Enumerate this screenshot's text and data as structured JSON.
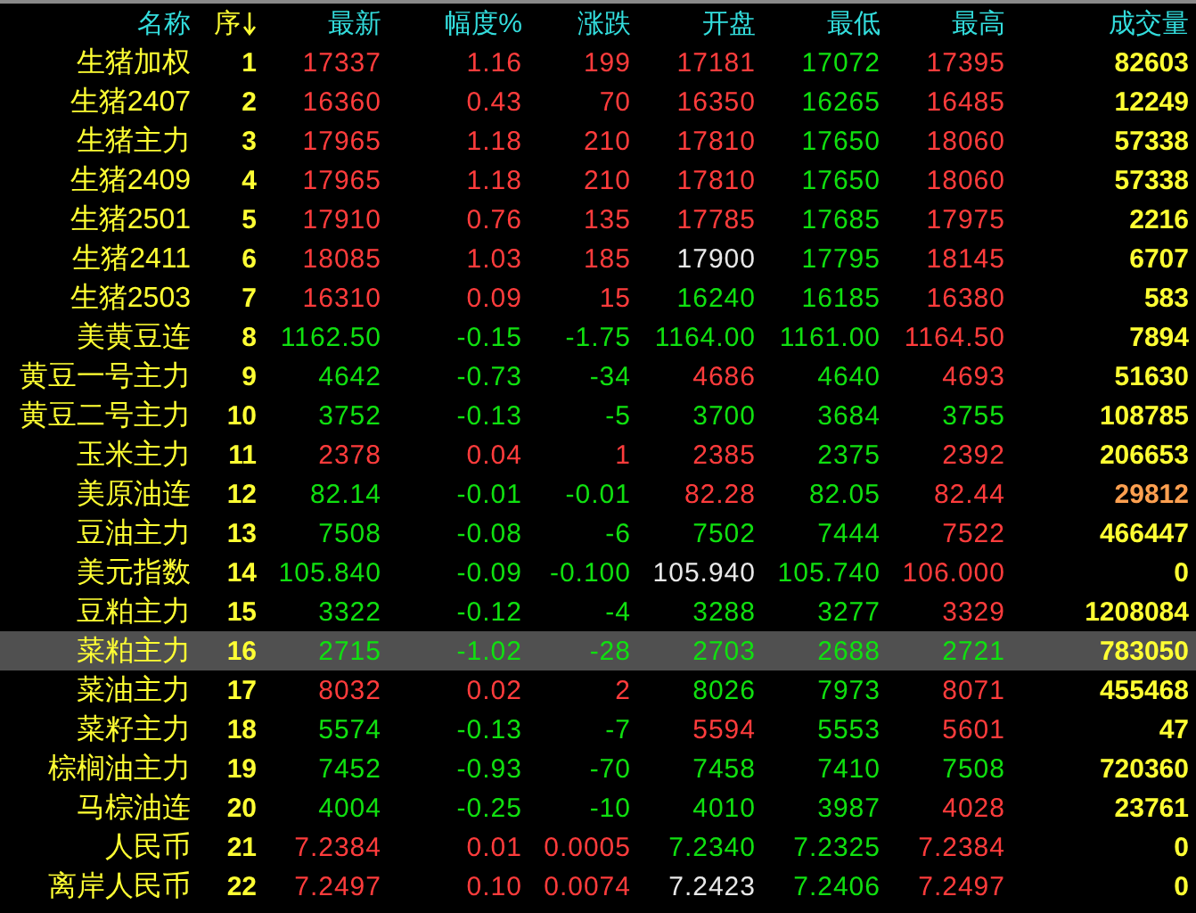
{
  "columns": [
    {
      "label": "名称",
      "sorted": false
    },
    {
      "label": "序",
      "sorted": true
    },
    {
      "label": "最新",
      "sorted": false
    },
    {
      "label": "幅度%",
      "sorted": false
    },
    {
      "label": "涨跌",
      "sorted": false
    },
    {
      "label": "开盘",
      "sorted": false
    },
    {
      "label": "最低",
      "sorted": false
    },
    {
      "label": "最高",
      "sorted": false
    },
    {
      "label": "成交量",
      "sorted": false
    }
  ],
  "rows": [
    {
      "name": "生猪加权",
      "seq": "1",
      "selected": false,
      "cells": [
        {
          "v": "17337",
          "color": "#ff3c3c"
        },
        {
          "v": "1.16",
          "color": "#ff3c3c"
        },
        {
          "v": "199",
          "color": "#ff3c3c"
        },
        {
          "v": "17181",
          "color": "#ff3c3c"
        },
        {
          "v": "17072",
          "color": "#10e010"
        },
        {
          "v": "17395",
          "color": "#ff3c3c"
        }
      ],
      "volume": {
        "v": "82603",
        "changed": false
      }
    },
    {
      "name": "生猪2407",
      "seq": "2",
      "selected": false,
      "cells": [
        {
          "v": "16360",
          "color": "#ff3c3c"
        },
        {
          "v": "0.43",
          "color": "#ff3c3c"
        },
        {
          "v": "70",
          "color": "#ff3c3c"
        },
        {
          "v": "16350",
          "color": "#ff3c3c"
        },
        {
          "v": "16265",
          "color": "#10e010"
        },
        {
          "v": "16485",
          "color": "#ff3c3c"
        }
      ],
      "volume": {
        "v": "12249",
        "changed": false
      }
    },
    {
      "name": "生猪主力",
      "seq": "3",
      "selected": false,
      "cells": [
        {
          "v": "17965",
          "color": "#ff3c3c"
        },
        {
          "v": "1.18",
          "color": "#ff3c3c"
        },
        {
          "v": "210",
          "color": "#ff3c3c"
        },
        {
          "v": "17810",
          "color": "#ff3c3c"
        },
        {
          "v": "17650",
          "color": "#10e010"
        },
        {
          "v": "18060",
          "color": "#ff3c3c"
        }
      ],
      "volume": {
        "v": "57338",
        "changed": false
      }
    },
    {
      "name": "生猪2409",
      "seq": "4",
      "selected": false,
      "cells": [
        {
          "v": "17965",
          "color": "#ff3c3c"
        },
        {
          "v": "1.18",
          "color": "#ff3c3c"
        },
        {
          "v": "210",
          "color": "#ff3c3c"
        },
        {
          "v": "17810",
          "color": "#ff3c3c"
        },
        {
          "v": "17650",
          "color": "#10e010"
        },
        {
          "v": "18060",
          "color": "#ff3c3c"
        }
      ],
      "volume": {
        "v": "57338",
        "changed": false
      }
    },
    {
      "name": "生猪2501",
      "seq": "5",
      "selected": false,
      "cells": [
        {
          "v": "17910",
          "color": "#ff3c3c"
        },
        {
          "v": "0.76",
          "color": "#ff3c3c"
        },
        {
          "v": "135",
          "color": "#ff3c3c"
        },
        {
          "v": "17785",
          "color": "#ff3c3c"
        },
        {
          "v": "17685",
          "color": "#10e010"
        },
        {
          "v": "17975",
          "color": "#ff3c3c"
        }
      ],
      "volume": {
        "v": "2216",
        "changed": false
      }
    },
    {
      "name": "生猪2411",
      "seq": "6",
      "selected": false,
      "cells": [
        {
          "v": "18085",
          "color": "#ff3c3c"
        },
        {
          "v": "1.03",
          "color": "#ff3c3c"
        },
        {
          "v": "185",
          "color": "#ff3c3c"
        },
        {
          "v": "17900",
          "color": "#e8e8e8"
        },
        {
          "v": "17795",
          "color": "#10e010"
        },
        {
          "v": "18145",
          "color": "#ff3c3c"
        }
      ],
      "volume": {
        "v": "6707",
        "changed": false
      }
    },
    {
      "name": "生猪2503",
      "seq": "7",
      "selected": false,
      "cells": [
        {
          "v": "16310",
          "color": "#ff3c3c"
        },
        {
          "v": "0.09",
          "color": "#ff3c3c"
        },
        {
          "v": "15",
          "color": "#ff3c3c"
        },
        {
          "v": "16240",
          "color": "#10e010"
        },
        {
          "v": "16185",
          "color": "#10e010"
        },
        {
          "v": "16380",
          "color": "#ff3c3c"
        }
      ],
      "volume": {
        "v": "583",
        "changed": false
      }
    },
    {
      "name": "美黄豆连",
      "seq": "8",
      "selected": false,
      "cells": [
        {
          "v": "1162.50",
          "color": "#10e010"
        },
        {
          "v": "-0.15",
          "color": "#10e010"
        },
        {
          "v": "-1.75",
          "color": "#10e010"
        },
        {
          "v": "1164.00",
          "color": "#10e010"
        },
        {
          "v": "1161.00",
          "color": "#10e010"
        },
        {
          "v": "1164.50",
          "color": "#ff3c3c"
        }
      ],
      "volume": {
        "v": "7894",
        "changed": false
      }
    },
    {
      "name": "黄豆一号主力",
      "seq": "9",
      "selected": false,
      "cells": [
        {
          "v": "4642",
          "color": "#10e010"
        },
        {
          "v": "-0.73",
          "color": "#10e010"
        },
        {
          "v": "-34",
          "color": "#10e010"
        },
        {
          "v": "4686",
          "color": "#ff3c3c"
        },
        {
          "v": "4640",
          "color": "#10e010"
        },
        {
          "v": "4693",
          "color": "#ff3c3c"
        }
      ],
      "volume": {
        "v": "51630",
        "changed": false
      }
    },
    {
      "name": "黄豆二号主力",
      "seq": "10",
      "selected": false,
      "cells": [
        {
          "v": "3752",
          "color": "#10e010"
        },
        {
          "v": "-0.13",
          "color": "#10e010"
        },
        {
          "v": "-5",
          "color": "#10e010"
        },
        {
          "v": "3700",
          "color": "#10e010"
        },
        {
          "v": "3684",
          "color": "#10e010"
        },
        {
          "v": "3755",
          "color": "#10e010"
        }
      ],
      "volume": {
        "v": "108785",
        "changed": false
      }
    },
    {
      "name": "玉米主力",
      "seq": "11",
      "selected": false,
      "cells": [
        {
          "v": "2378",
          "color": "#ff3c3c"
        },
        {
          "v": "0.04",
          "color": "#ff3c3c"
        },
        {
          "v": "1",
          "color": "#ff3c3c"
        },
        {
          "v": "2385",
          "color": "#ff3c3c"
        },
        {
          "v": "2375",
          "color": "#10e010"
        },
        {
          "v": "2392",
          "color": "#ff3c3c"
        }
      ],
      "volume": {
        "v": "206653",
        "changed": false
      }
    },
    {
      "name": "美原油连",
      "seq": "12",
      "selected": false,
      "cells": [
        {
          "v": "82.14",
          "color": "#10e010"
        },
        {
          "v": "-0.01",
          "color": "#10e010"
        },
        {
          "v": "-0.01",
          "color": "#10e010"
        },
        {
          "v": "82.28",
          "color": "#ff3c3c"
        },
        {
          "v": "82.05",
          "color": "#10e010"
        },
        {
          "v": "82.44",
          "color": "#ff3c3c"
        }
      ],
      "volume": {
        "v": "29812",
        "changed": true
      }
    },
    {
      "name": "豆油主力",
      "seq": "13",
      "selected": false,
      "cells": [
        {
          "v": "7508",
          "color": "#10e010"
        },
        {
          "v": "-0.08",
          "color": "#10e010"
        },
        {
          "v": "-6",
          "color": "#10e010"
        },
        {
          "v": "7502",
          "color": "#10e010"
        },
        {
          "v": "7444",
          "color": "#10e010"
        },
        {
          "v": "7522",
          "color": "#ff3c3c"
        }
      ],
      "volume": {
        "v": "466447",
        "changed": false
      }
    },
    {
      "name": "美元指数",
      "seq": "14",
      "selected": false,
      "cells": [
        {
          "v": "105.840",
          "color": "#10e010"
        },
        {
          "v": "-0.09",
          "color": "#10e010"
        },
        {
          "v": "-0.100",
          "color": "#10e010"
        },
        {
          "v": "105.940",
          "color": "#e8e8e8"
        },
        {
          "v": "105.740",
          "color": "#10e010"
        },
        {
          "v": "106.000",
          "color": "#ff3c3c"
        }
      ],
      "volume": {
        "v": "0",
        "changed": false
      }
    },
    {
      "name": "豆粕主力",
      "seq": "15",
      "selected": false,
      "cells": [
        {
          "v": "3322",
          "color": "#10e010"
        },
        {
          "v": "-0.12",
          "color": "#10e010"
        },
        {
          "v": "-4",
          "color": "#10e010"
        },
        {
          "v": "3288",
          "color": "#10e010"
        },
        {
          "v": "3277",
          "color": "#10e010"
        },
        {
          "v": "3329",
          "color": "#ff3c3c"
        }
      ],
      "volume": {
        "v": "1208084",
        "changed": false
      }
    },
    {
      "name": "菜粕主力",
      "seq": "16",
      "selected": true,
      "cells": [
        {
          "v": "2715",
          "color": "#10e010"
        },
        {
          "v": "-1.02",
          "color": "#10e010"
        },
        {
          "v": "-28",
          "color": "#10e010"
        },
        {
          "v": "2703",
          "color": "#10e010"
        },
        {
          "v": "2688",
          "color": "#10e010"
        },
        {
          "v": "2721",
          "color": "#10e010"
        }
      ],
      "volume": {
        "v": "783050",
        "changed": false
      }
    },
    {
      "name": "菜油主力",
      "seq": "17",
      "selected": false,
      "cells": [
        {
          "v": "8032",
          "color": "#ff3c3c"
        },
        {
          "v": "0.02",
          "color": "#ff3c3c"
        },
        {
          "v": "2",
          "color": "#ff3c3c"
        },
        {
          "v": "8026",
          "color": "#10e010"
        },
        {
          "v": "7973",
          "color": "#10e010"
        },
        {
          "v": "8071",
          "color": "#ff3c3c"
        }
      ],
      "volume": {
        "v": "455468",
        "changed": false
      }
    },
    {
      "name": "菜籽主力",
      "seq": "18",
      "selected": false,
      "cells": [
        {
          "v": "5574",
          "color": "#10e010"
        },
        {
          "v": "-0.13",
          "color": "#10e010"
        },
        {
          "v": "-7",
          "color": "#10e010"
        },
        {
          "v": "5594",
          "color": "#ff3c3c"
        },
        {
          "v": "5553",
          "color": "#10e010"
        },
        {
          "v": "5601",
          "color": "#ff3c3c"
        }
      ],
      "volume": {
        "v": "47",
        "changed": false
      }
    },
    {
      "name": "棕榈油主力",
      "seq": "19",
      "selected": false,
      "cells": [
        {
          "v": "7452",
          "color": "#10e010"
        },
        {
          "v": "-0.93",
          "color": "#10e010"
        },
        {
          "v": "-70",
          "color": "#10e010"
        },
        {
          "v": "7458",
          "color": "#10e010"
        },
        {
          "v": "7410",
          "color": "#10e010"
        },
        {
          "v": "7508",
          "color": "#10e010"
        }
      ],
      "volume": {
        "v": "720360",
        "changed": false
      }
    },
    {
      "name": "马棕油连",
      "seq": "20",
      "selected": false,
      "cells": [
        {
          "v": "4004",
          "color": "#10e010"
        },
        {
          "v": "-0.25",
          "color": "#10e010"
        },
        {
          "v": "-10",
          "color": "#10e010"
        },
        {
          "v": "4010",
          "color": "#10e010"
        },
        {
          "v": "3987",
          "color": "#10e010"
        },
        {
          "v": "4028",
          "color": "#ff3c3c"
        }
      ],
      "volume": {
        "v": "23761",
        "changed": false
      }
    },
    {
      "name": "人民币",
      "seq": "21",
      "selected": false,
      "cells": [
        {
          "v": "7.2384",
          "color": "#ff3c3c"
        },
        {
          "v": "0.01",
          "color": "#ff3c3c"
        },
        {
          "v": "0.0005",
          "color": "#ff3c3c"
        },
        {
          "v": "7.2340",
          "color": "#10e010"
        },
        {
          "v": "7.2325",
          "color": "#10e010"
        },
        {
          "v": "7.2384",
          "color": "#ff3c3c"
        }
      ],
      "volume": {
        "v": "0",
        "changed": false
      }
    },
    {
      "name": "离岸人民币",
      "seq": "22",
      "selected": false,
      "cells": [
        {
          "v": "7.2497",
          "color": "#ff3c3c"
        },
        {
          "v": "0.10",
          "color": "#ff3c3c"
        },
        {
          "v": "0.0074",
          "color": "#ff3c3c"
        },
        {
          "v": "7.2423",
          "color": "#e8e8e8"
        },
        {
          "v": "7.2406",
          "color": "#10e010"
        },
        {
          "v": "7.2497",
          "color": "#ff3c3c"
        }
      ],
      "volume": {
        "v": "0",
        "changed": false
      }
    }
  ]
}
